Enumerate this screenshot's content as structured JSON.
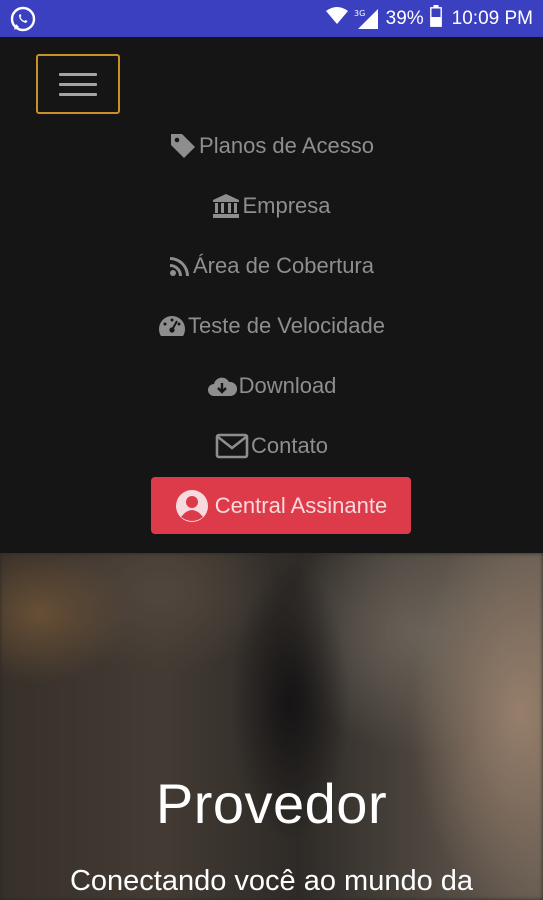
{
  "status_bar": {
    "battery": "39%",
    "time": "10:09 PM",
    "network": "3G"
  },
  "nav": {
    "menu_button_icon": "hamburger-icon",
    "items": [
      {
        "label": "Planos de Acesso",
        "icon": "tag-icon"
      },
      {
        "label": "Empresa",
        "icon": "bank-icon"
      },
      {
        "label": "Área de Cobertura",
        "icon": "rss-icon"
      },
      {
        "label": "Teste de Velocidade",
        "icon": "speedometer-icon"
      },
      {
        "label": "Download",
        "icon": "cloud-download-icon"
      },
      {
        "label": "Contato",
        "icon": "envelope-icon"
      }
    ],
    "cta": {
      "label": "Central Assinante",
      "icon": "user-circle-icon"
    }
  },
  "hero": {
    "title": "Provedor",
    "subtitle": "Conectando você ao mundo da"
  },
  "colors": {
    "status_bar": "#3a40c0",
    "background": "#151515",
    "menu_text": "#8e8e8e",
    "menu_button_border": "#c7902a",
    "cta": "#dd3a4a"
  }
}
